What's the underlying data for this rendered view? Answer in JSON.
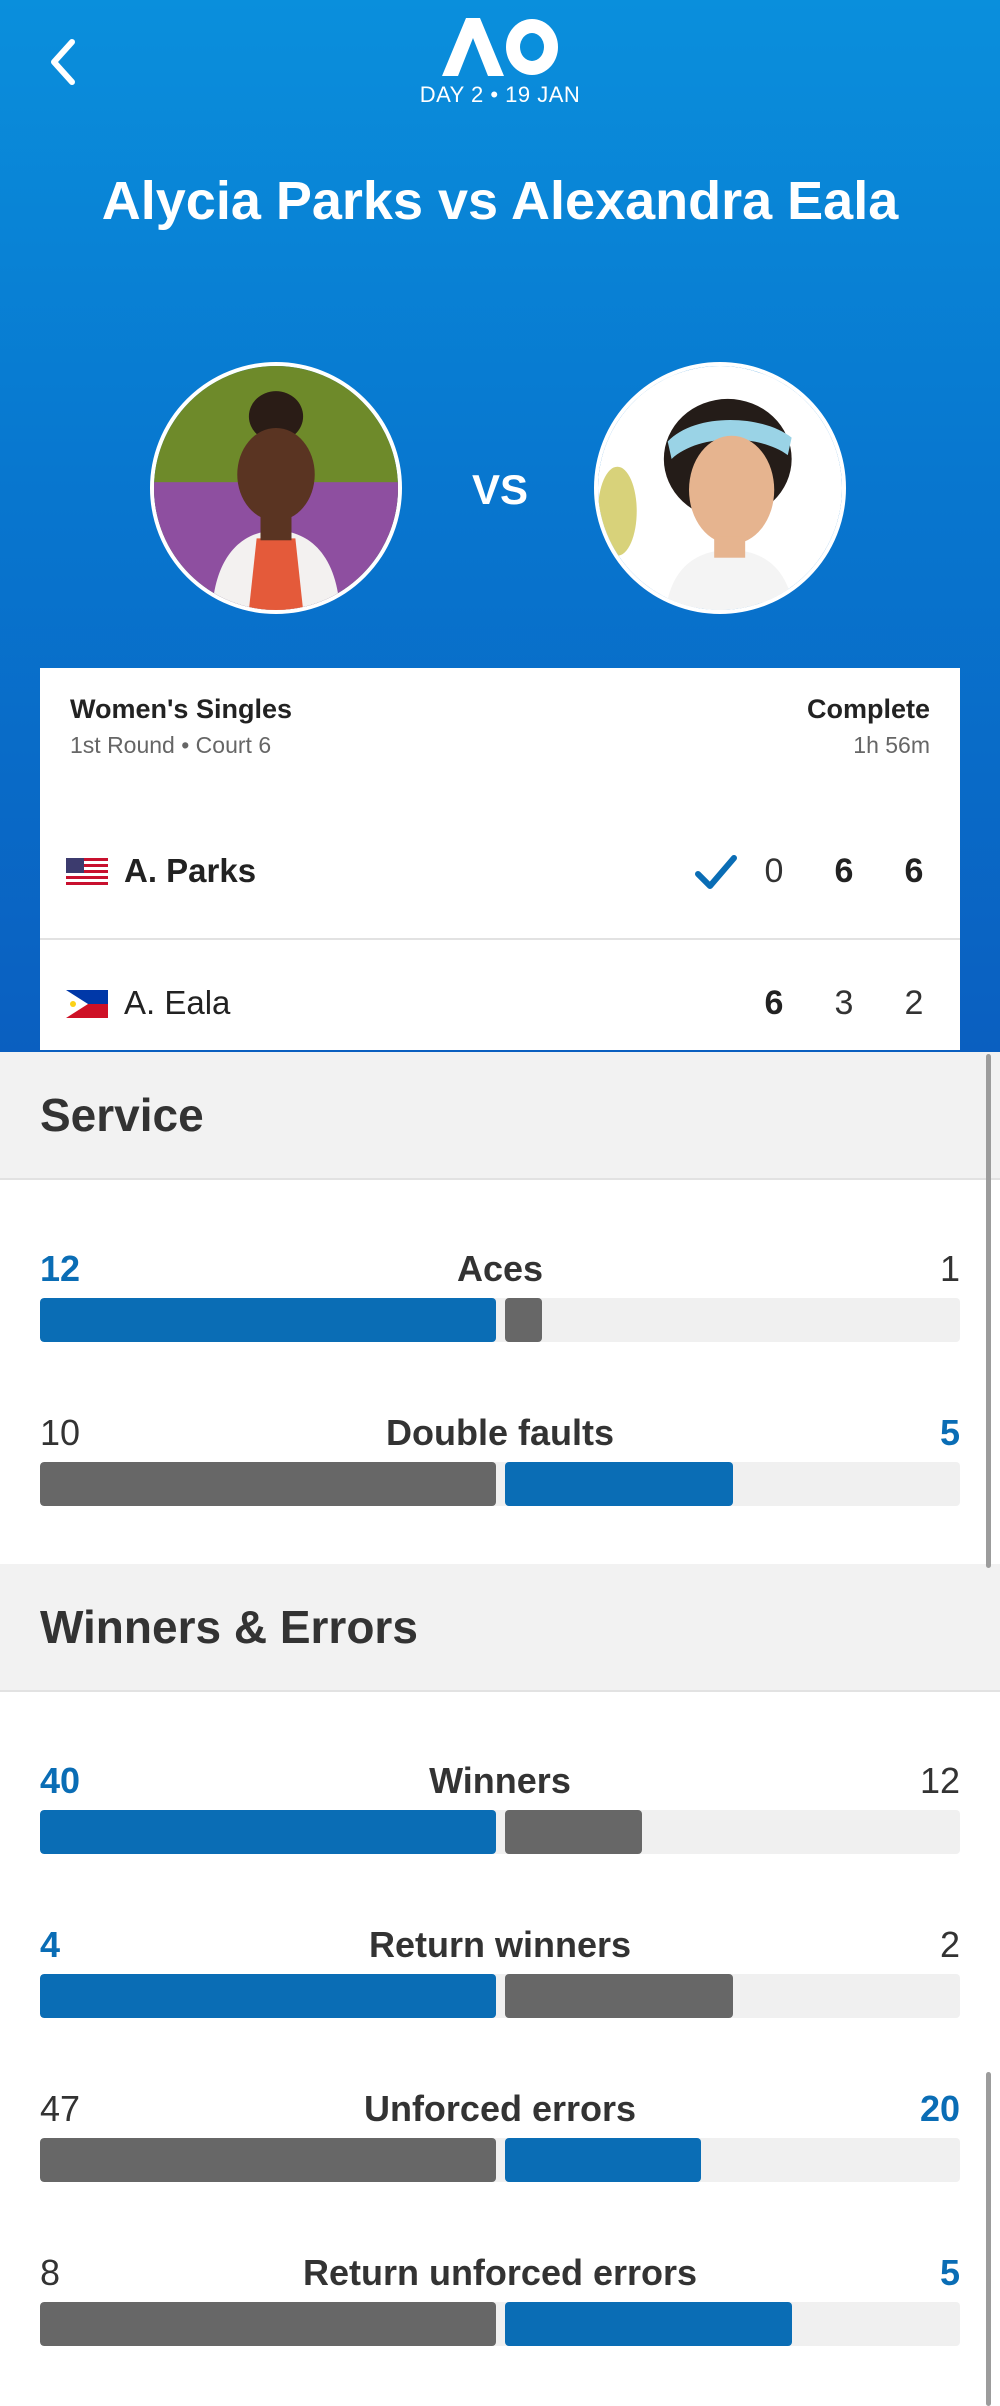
{
  "header": {
    "logo_text": "AO",
    "day": "DAY 2 • 19 JAN",
    "match_title": "Alycia Parks vs Alexandra Eala",
    "vs": "VS"
  },
  "match": {
    "event": "Women's Singles",
    "round_court": "1st Round • Court 6",
    "status": "Complete",
    "duration": "1h 56m",
    "players": [
      {
        "name": "A. Parks",
        "country": "USA",
        "winner": true,
        "sets": [
          "0",
          "6",
          "6"
        ],
        "set_won": [
          false,
          true,
          true
        ]
      },
      {
        "name": "A. Eala",
        "country": "PHI",
        "winner": false,
        "sets": [
          "6",
          "3",
          "2"
        ],
        "set_won": [
          true,
          false,
          false
        ]
      }
    ]
  },
  "sections": [
    {
      "title": "Service",
      "stats": [
        {
          "label": "Aces",
          "left": "12",
          "right": "1",
          "leader": "left"
        },
        {
          "label": "Double faults",
          "left": "10",
          "right": "5",
          "leader": "right"
        }
      ]
    },
    {
      "title": "Winners & Errors",
      "stats": [
        {
          "label": "Winners",
          "left": "40",
          "right": "12",
          "leader": "left"
        },
        {
          "label": "Return winners",
          "left": "4",
          "right": "2",
          "leader": "left"
        },
        {
          "label": "Unforced errors",
          "left": "47",
          "right": "20",
          "leader": "right"
        },
        {
          "label": "Return unforced errors",
          "left": "8",
          "right": "5",
          "leader": "right"
        }
      ]
    }
  ],
  "colors": {
    "accent_blue": "#0a6db5",
    "bar_grey": "#676767",
    "track": "#f0f0f0",
    "hero_top": "#0a8fdc",
    "hero_bottom": "#0a5fc0"
  },
  "icons": [
    "back-chevron-icon",
    "checkmark-icon",
    "us-flag-icon",
    "ph-flag-icon"
  ]
}
